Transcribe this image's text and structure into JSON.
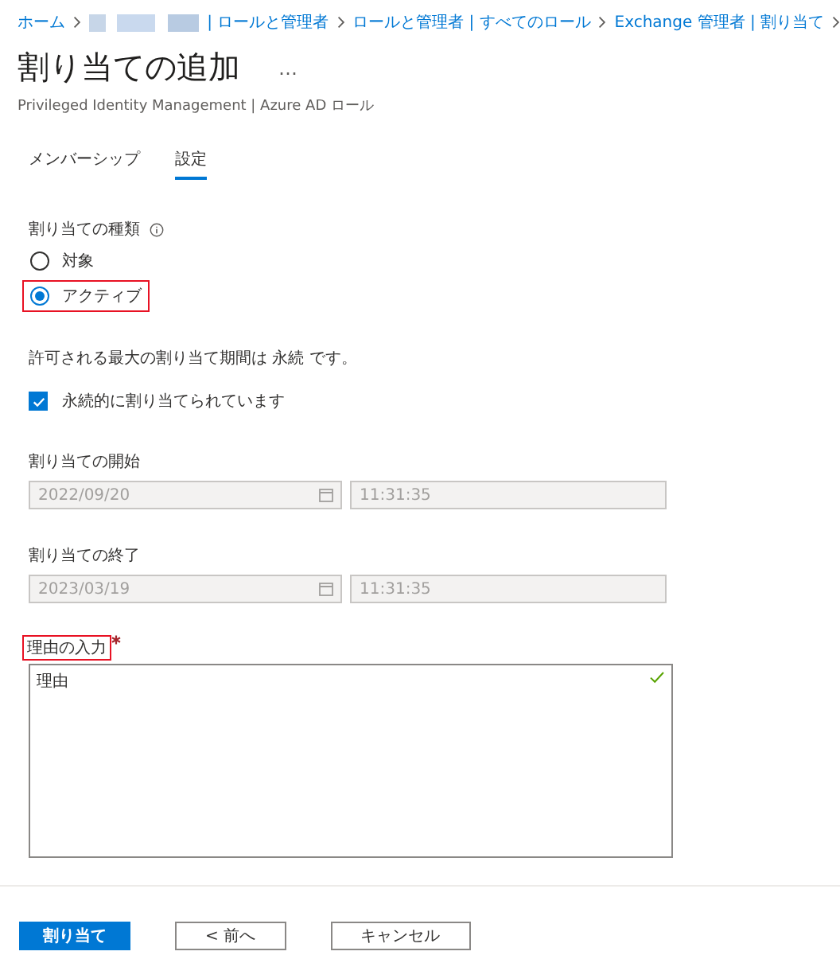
{
  "breadcrumb": [
    {
      "label": "ホーム",
      "redacted_prefix": false
    },
    {
      "label": "| ロールと管理者",
      "redacted_prefix": true
    },
    {
      "label": "ロールと管理者 | すべてのロール",
      "redacted_prefix": false
    },
    {
      "label": "Exchange 管理者 | 割り当て",
      "redacted_prefix": false
    }
  ],
  "title": "割り当ての追加",
  "more": "…",
  "subtitle": "Privileged Identity Management | Azure AD ロール",
  "tabs": [
    {
      "label": "メンバーシップ",
      "selected": false
    },
    {
      "label": "設定",
      "selected": true
    }
  ],
  "assignment_type": {
    "label": "割り当ての種類",
    "options": [
      {
        "label": "対象",
        "selected": false,
        "highlighted": false
      },
      {
        "label": "アクティブ",
        "selected": true,
        "highlighted": true
      }
    ]
  },
  "info_text": "許可される最大の割り当て期間は 永続 です。",
  "permanent": {
    "label": "永続的に割り当てられています",
    "checked": true
  },
  "date_groups": [
    {
      "label": "割り当ての開始",
      "date": "2022/09/20",
      "time": "11:31:35"
    },
    {
      "label": "割り当ての終了",
      "date": "2023/03/19",
      "time": "11:31:35"
    }
  ],
  "reason": {
    "label": "理由の入力",
    "required": true,
    "highlighted": true,
    "value": "理由",
    "valid": true
  },
  "buttons": [
    {
      "label": "割り当て",
      "kind": "primary"
    },
    {
      "label": "< 前へ",
      "kind": "secondary"
    },
    {
      "label": "キャンセル",
      "kind": "secondary"
    }
  ]
}
